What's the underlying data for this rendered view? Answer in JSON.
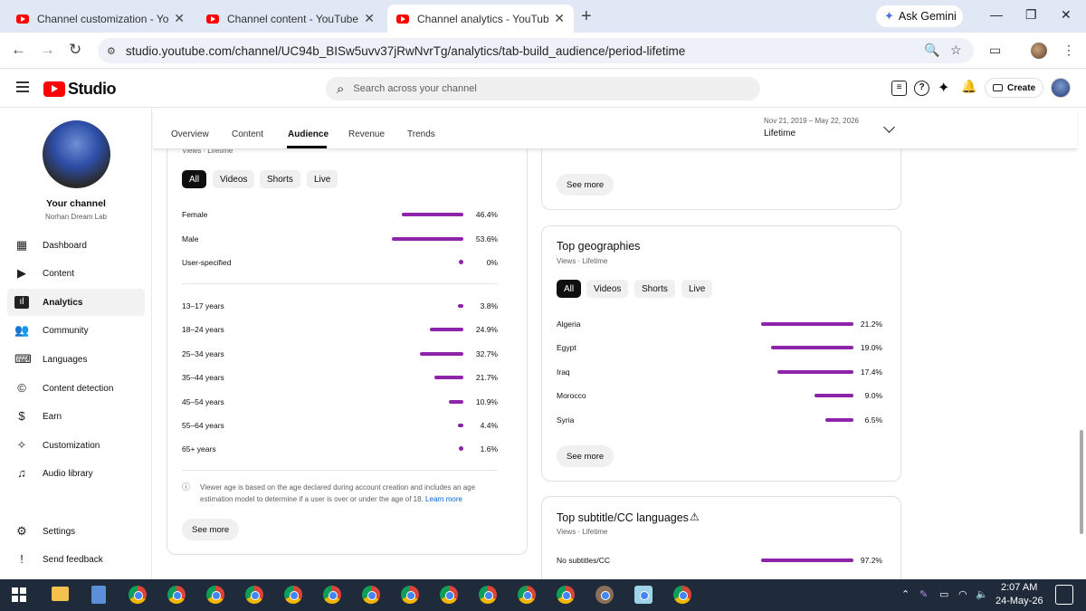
{
  "browser": {
    "tabs": [
      {
        "title": "Channel customization - YouTu"
      },
      {
        "title": "Channel content - YouTube Stu"
      },
      {
        "title": "Channel analytics - YouTube St"
      }
    ],
    "ask_gemini": "Ask Gemini",
    "url": "studio.youtube.com/channel/UC94b_BISw5uvv37jRwNvrTg/analytics/tab-build_audience/period-lifetime"
  },
  "header": {
    "logo_text": "Studio",
    "search_placeholder": "Search across your channel",
    "create_label": "Create"
  },
  "sidebar": {
    "your_channel": "Your channel",
    "channel_name": "Norhan Dream Lab",
    "items": [
      {
        "label": "Dashboard",
        "icon": "dashboard-icon"
      },
      {
        "label": "Content",
        "icon": "content-icon"
      },
      {
        "label": "Analytics",
        "icon": "analytics-icon"
      },
      {
        "label": "Community",
        "icon": "community-icon"
      },
      {
        "label": "Languages",
        "icon": "languages-icon"
      },
      {
        "label": "Content detection",
        "icon": "copyright-icon"
      },
      {
        "label": "Earn",
        "icon": "dollar-icon"
      },
      {
        "label": "Customization",
        "icon": "wand-icon"
      },
      {
        "label": "Audio library",
        "icon": "audio-library-icon"
      }
    ],
    "footer": [
      {
        "label": "Settings",
        "icon": "gear-icon"
      },
      {
        "label": "Send feedback",
        "icon": "feedback-icon"
      }
    ]
  },
  "analytics_tabs": [
    "Overview",
    "Content",
    "Audience",
    "Revenue",
    "Trends"
  ],
  "period": {
    "range": "Nov 21, 2019 – May 22, 2026",
    "label": "Lifetime"
  },
  "demographics": {
    "subtitle": "Views · Lifetime",
    "chips": [
      "All",
      "Videos",
      "Shorts",
      "Live"
    ],
    "gender": [
      {
        "label": "Female",
        "value": 46.4,
        "text": "46.4%"
      },
      {
        "label": "Male",
        "value": 53.6,
        "text": "53.6%"
      },
      {
        "label": "User-specified",
        "value": 0,
        "text": "0%"
      }
    ],
    "age": [
      {
        "label": "13–17 years",
        "value": 3.8,
        "text": "3.8%"
      },
      {
        "label": "18–24 years",
        "value": 24.9,
        "text": "24.9%"
      },
      {
        "label": "25–34 years",
        "value": 32.7,
        "text": "32.7%"
      },
      {
        "label": "35–44 years",
        "value": 21.7,
        "text": "21.7%"
      },
      {
        "label": "45–54 years",
        "value": 10.9,
        "text": "10.9%"
      },
      {
        "label": "55–64 years",
        "value": 4.4,
        "text": "4.4%"
      },
      {
        "label": "65+ years",
        "value": 1.6,
        "text": "1.6%"
      }
    ],
    "note": "Viewer age is based on the age declared during account creation and includes an age estimation model to determine if a user is over or under the age of 18.",
    "learn_more": "Learn more",
    "see_more": "See more"
  },
  "top_card": {
    "see_more": "See more"
  },
  "geographies": {
    "title": "Top geographies",
    "subtitle": "Views · Lifetime",
    "chips": [
      "All",
      "Videos",
      "Shorts",
      "Live"
    ],
    "rows": [
      {
        "label": "Algeria",
        "value": 21.2,
        "text": "21.2%"
      },
      {
        "label": "Egypt",
        "value": 19.0,
        "text": "19.0%"
      },
      {
        "label": "Iraq",
        "value": 17.4,
        "text": "17.4%"
      },
      {
        "label": "Morocco",
        "value": 9.0,
        "text": "9.0%"
      },
      {
        "label": "Syria",
        "value": 6.5,
        "text": "6.5%"
      }
    ],
    "see_more": "See more"
  },
  "subtitles": {
    "title": "Top subtitle/CC languages",
    "subtitle": "Views · Lifetime",
    "rows": [
      {
        "label": "No subtitles/CC",
        "value": 97.2,
        "text": "97.2%"
      }
    ]
  },
  "taskbar": {
    "time": "2:07 AM",
    "date": "24-May-26"
  },
  "colors": {
    "accent": "#8e24aa",
    "brand": "#ff0000"
  }
}
